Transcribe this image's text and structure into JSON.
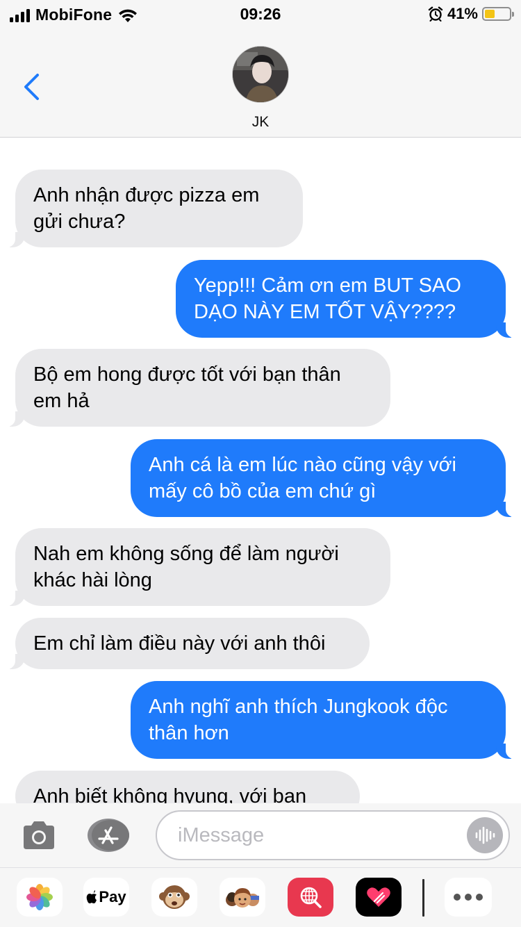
{
  "status_bar": {
    "carrier": "MobiFone",
    "time": "09:26",
    "battery_percent": "41%",
    "battery_level": 0.41,
    "icons": [
      "signal-icon",
      "wifi-icon",
      "alarm-icon",
      "battery-icon"
    ]
  },
  "header": {
    "contact_name": "JK"
  },
  "messages": [
    {
      "direction": "incoming",
      "text": "Anh nhận được pizza em gửi chưa?"
    },
    {
      "direction": "outgoing",
      "text": "Yepp!!! Cảm ơn em BUT SAO DẠO NÀY EM TỐT VẬY????"
    },
    {
      "direction": "incoming",
      "text": "Bộ em hong được tốt với bạn thân em hả"
    },
    {
      "direction": "outgoing",
      "text": "Anh cá là em lúc nào cũng vậy với mấy cô bồ của em chứ gì"
    },
    {
      "direction": "incoming",
      "text": "Nah em không sống để làm người khác hài lòng"
    },
    {
      "direction": "incoming",
      "text": "Em chỉ làm điều này với anh thôi"
    },
    {
      "direction": "outgoing",
      "text": "Anh nghĩ anh thích Jungkook độc thân hơn"
    },
    {
      "direction": "incoming",
      "text": "Anh biết không hyung, với bạn"
    }
  ],
  "composer": {
    "placeholder": "iMessage",
    "value": ""
  },
  "app_drawer": {
    "apple_pay_label": "Pay",
    "apps": [
      "photos-app",
      "apple-pay-app",
      "animoji-app",
      "memoji-app",
      "web-search-app",
      "digital-touch-app",
      "more-apps"
    ]
  },
  "colors": {
    "outgoing_bubble": "#1f7bfb",
    "incoming_bubble": "#e9e9eb",
    "accent": "#1f7bfb",
    "battery_fill": "#f3c416"
  }
}
